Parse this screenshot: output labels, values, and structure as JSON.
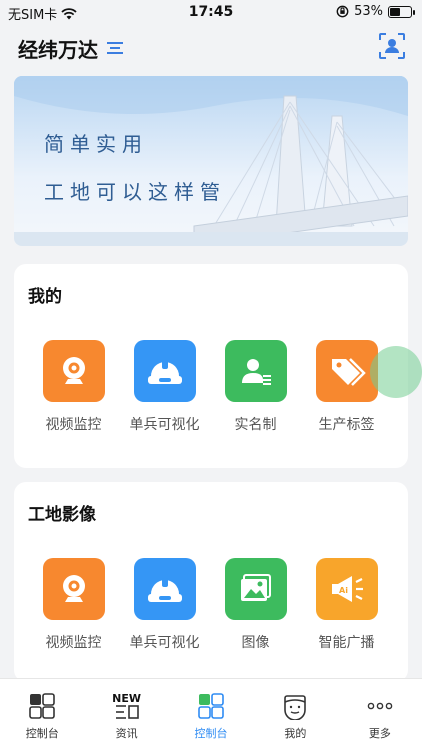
{
  "status_bar": {
    "carrier": "无SIM卡",
    "time": "17:45",
    "battery": "53%",
    "battery_level": 0.53
  },
  "header": {
    "title": "经纬万达"
  },
  "banner": {
    "line1": "简单实用",
    "line2": "工地可以这样管"
  },
  "mine": {
    "title": "我的",
    "items": [
      {
        "label": "视频监控",
        "icon": "camera-icon"
      },
      {
        "label": "单兵可视化",
        "icon": "helmet-icon"
      },
      {
        "label": "实名制",
        "icon": "id-person-icon"
      },
      {
        "label": "生产标签",
        "icon": "tag-icon"
      }
    ]
  },
  "site_media": {
    "title": "工地影像",
    "items": [
      {
        "label": "视频监控",
        "icon": "camera-icon"
      },
      {
        "label": "单兵可视化",
        "icon": "helmet-icon"
      },
      {
        "label": "图像",
        "icon": "image-icon"
      },
      {
        "label": "智能广播",
        "icon": "broadcast-icon"
      }
    ]
  },
  "tabbar": {
    "items": [
      {
        "label": "控制台",
        "icon": "dashboard-icon"
      },
      {
        "label": "资讯",
        "icon": "news-icon",
        "badge": "NEW"
      },
      {
        "label": "控制台",
        "icon": "dashboard-icon",
        "active": true
      },
      {
        "label": "我的",
        "icon": "face-icon"
      },
      {
        "label": "更多",
        "icon": "more-icon"
      }
    ]
  },
  "colors": {
    "accent": "#2f8cf3",
    "orange": "#f7882f",
    "blue": "#3596f5",
    "green": "#3dbb5e",
    "amber": "#f8a52b"
  }
}
